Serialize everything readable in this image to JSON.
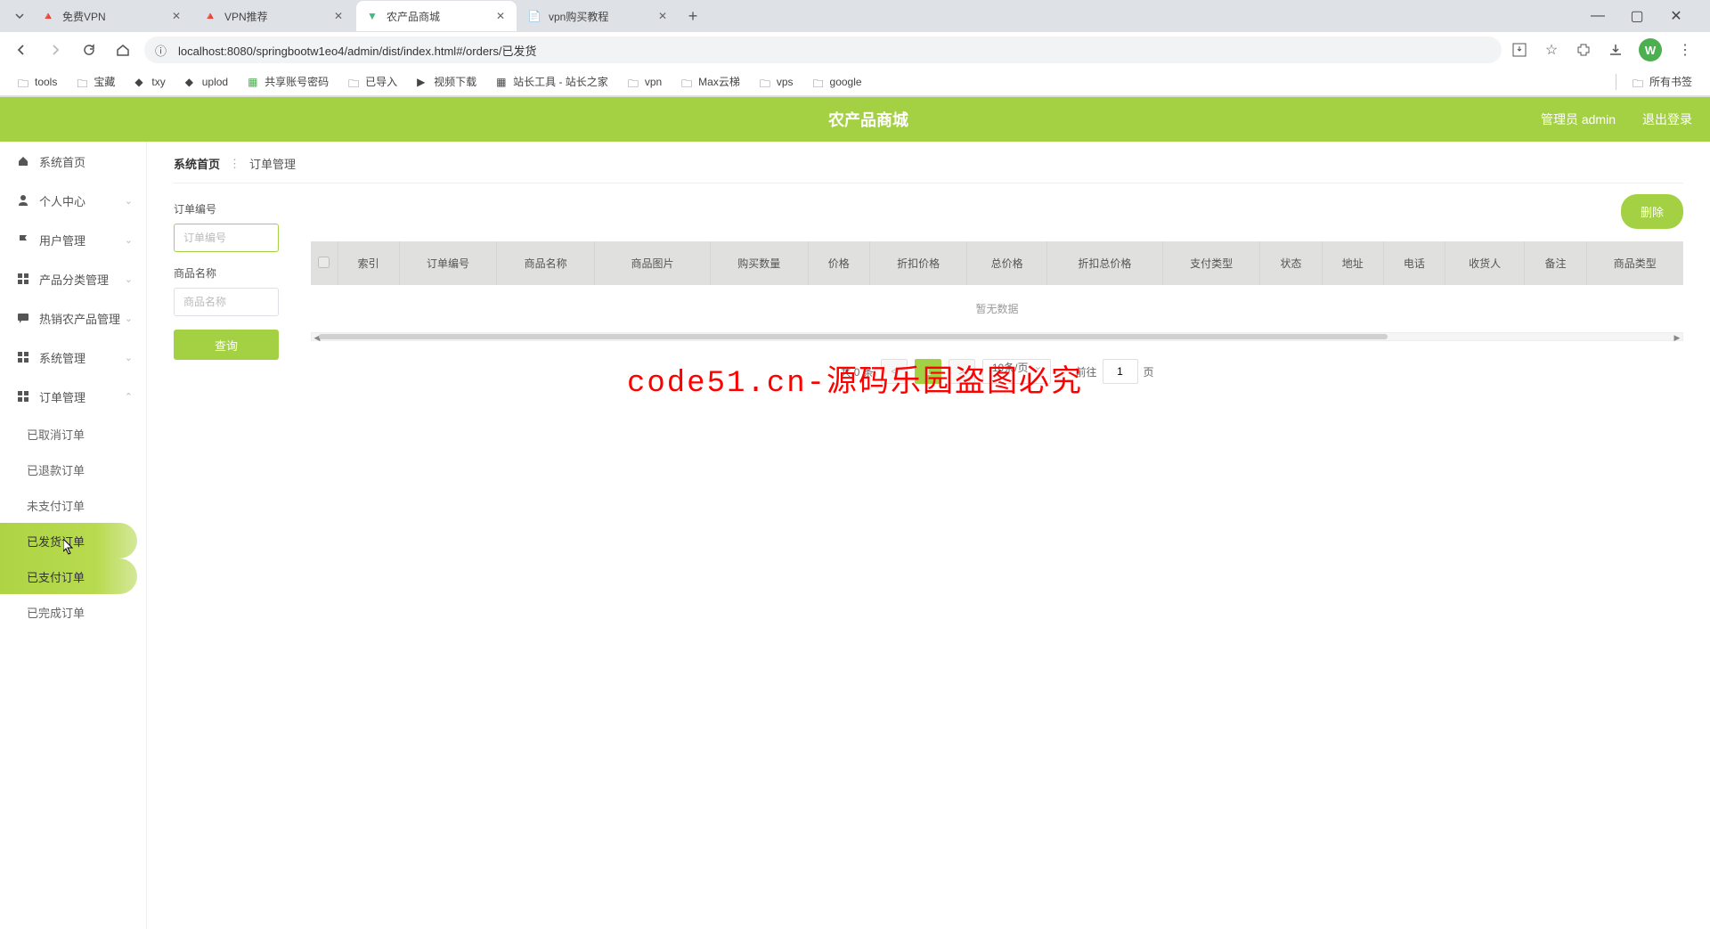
{
  "browser": {
    "tabs": [
      {
        "title": "免费VPN",
        "active": false
      },
      {
        "title": "VPN推荐",
        "active": false
      },
      {
        "title": "农产品商城",
        "active": true
      },
      {
        "title": "vpn购买教程",
        "active": false
      }
    ],
    "url": "localhost:8080/springbootw1eo4/admin/dist/index.html#/orders/已发货",
    "avatar_letter": "W",
    "bookmarks": [
      "tools",
      "宝藏",
      "txy",
      "uplod",
      "共享账号密码",
      "已导入",
      "视频下载",
      "站长工具 - 站长之家",
      "vpn",
      "Max云梯",
      "vps",
      "google"
    ],
    "all_bookmarks": "所有书签"
  },
  "header": {
    "title": "农产品商城",
    "admin": "管理员 admin",
    "logout": "退出登录"
  },
  "sidebar": {
    "items": [
      {
        "label": "系统首页",
        "icon": "home"
      },
      {
        "label": "个人中心",
        "icon": "person",
        "arrow": true
      },
      {
        "label": "用户管理",
        "icon": "flag",
        "arrow": true
      },
      {
        "label": "产品分类管理",
        "icon": "grid",
        "arrow": true
      },
      {
        "label": "热销农产品管理",
        "icon": "chat",
        "arrow": true
      },
      {
        "label": "系统管理",
        "icon": "grid",
        "arrow": true
      },
      {
        "label": "订单管理",
        "icon": "grid",
        "arrow": true,
        "expanded": true
      }
    ],
    "submenu": [
      {
        "label": "已取消订单"
      },
      {
        "label": "已退款订单"
      },
      {
        "label": "未支付订单"
      },
      {
        "label": "已发货订单",
        "active": true
      },
      {
        "label": "已支付订单",
        "hover": true
      },
      {
        "label": "已完成订单"
      }
    ]
  },
  "breadcrumb": {
    "home": "系统首页",
    "current": "订单管理"
  },
  "search": {
    "field1_label": "订单编号",
    "field1_placeholder": "订单编号",
    "field2_label": "商品名称",
    "field2_placeholder": "商品名称",
    "button": "查询"
  },
  "table": {
    "delete_btn": "删除",
    "columns": [
      "索引",
      "订单编号",
      "商品名称",
      "商品图片",
      "购买数量",
      "价格",
      "折扣价格",
      "总价格",
      "折扣总价格",
      "支付类型",
      "状态",
      "地址",
      "电话",
      "收货人",
      "备注",
      "商品类型"
    ],
    "empty": "暂无数据"
  },
  "pagination": {
    "total": "共 0 条",
    "page": "1",
    "per_page": "10条/页",
    "goto_label": "前往",
    "goto_value": "1",
    "goto_suffix": "页"
  },
  "watermark": "code51.cn-源码乐园盗图必究"
}
